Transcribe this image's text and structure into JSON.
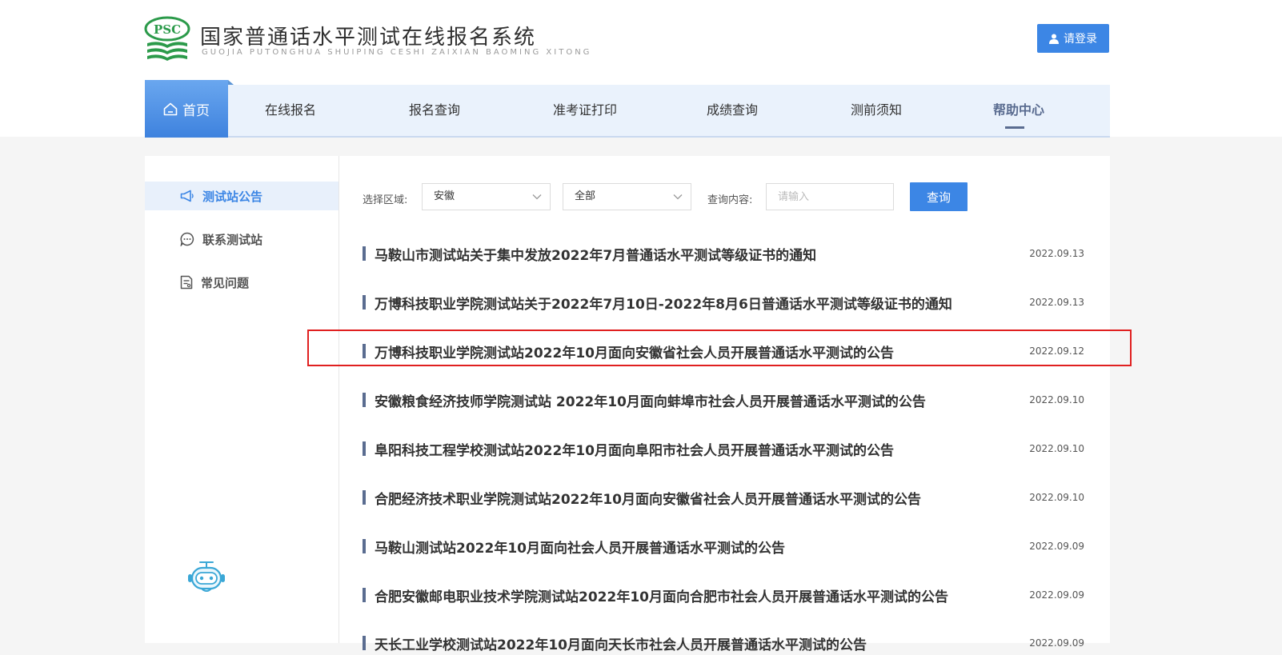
{
  "header": {
    "logo_badge": "PSC",
    "title": "国家普通话水平测试在线报名系统",
    "subtitle": "GUOJIA PUTONGHUA SHUIPING CESHI ZAIXIAN BAOMING XITONG",
    "login_label": "请登录",
    "brand_color": "#2b9a4a",
    "accent_color": "#3c86e5"
  },
  "nav": {
    "home": "首页",
    "items": [
      "在线报名",
      "报名查询",
      "准考证打印",
      "成绩查询",
      "测前须知",
      "帮助中心"
    ],
    "active": "帮助中心"
  },
  "sidebar": {
    "items": [
      {
        "label": "测试站公告",
        "icon": "megaphone-icon"
      },
      {
        "label": "联系测试站",
        "icon": "chat-icon"
      },
      {
        "label": "常见问题",
        "icon": "document-icon"
      }
    ]
  },
  "filters": {
    "region_label": "选择区域:",
    "region_value": "安徽",
    "scope_value": "全部",
    "query_label": "查询内容:",
    "query_placeholder": "请输入",
    "query_button": "查询"
  },
  "notices": [
    {
      "title": "马鞍山市测试站关于集中发放2022年7月普通话水平测试等级证书的通知",
      "date": "2022.09.13"
    },
    {
      "title": "万博科技职业学院测试站关于2022年7月10日-2022年8月6日普通话水平测试等级证书的通知",
      "date": "2022.09.13"
    },
    {
      "title": "万博科技职业学院测试站2022年10月面向安徽省社会人员开展普通话水平测试的公告",
      "date": "2022.09.12"
    },
    {
      "title": "安徽粮食经济技师学院测试站 2022年10月面向蚌埠市社会人员开展普通话水平测试的公告",
      "date": "2022.09.10"
    },
    {
      "title": "阜阳科技工程学校测试站2022年10月面向阜阳市社会人员开展普通话水平测试的公告",
      "date": "2022.09.10"
    },
    {
      "title": "合肥经济技术职业学院测试站2022年10月面向安徽省社会人员开展普通话水平测试的公告",
      "date": "2022.09.10"
    },
    {
      "title": "马鞍山测试站2022年10月面向社会人员开展普通话水平测试的公告",
      "date": "2022.09.09"
    },
    {
      "title": "合肥安徽邮电职业技术学院测试站2022年10月面向合肥市社会人员开展普通话水平测试的公告",
      "date": "2022.09.09"
    },
    {
      "title": "天长工业学校测试站2022年10月面向天长市社会人员开展普通话水平测试的公告",
      "date": "2022.09.09"
    }
  ],
  "highlight_color": "#e02020"
}
